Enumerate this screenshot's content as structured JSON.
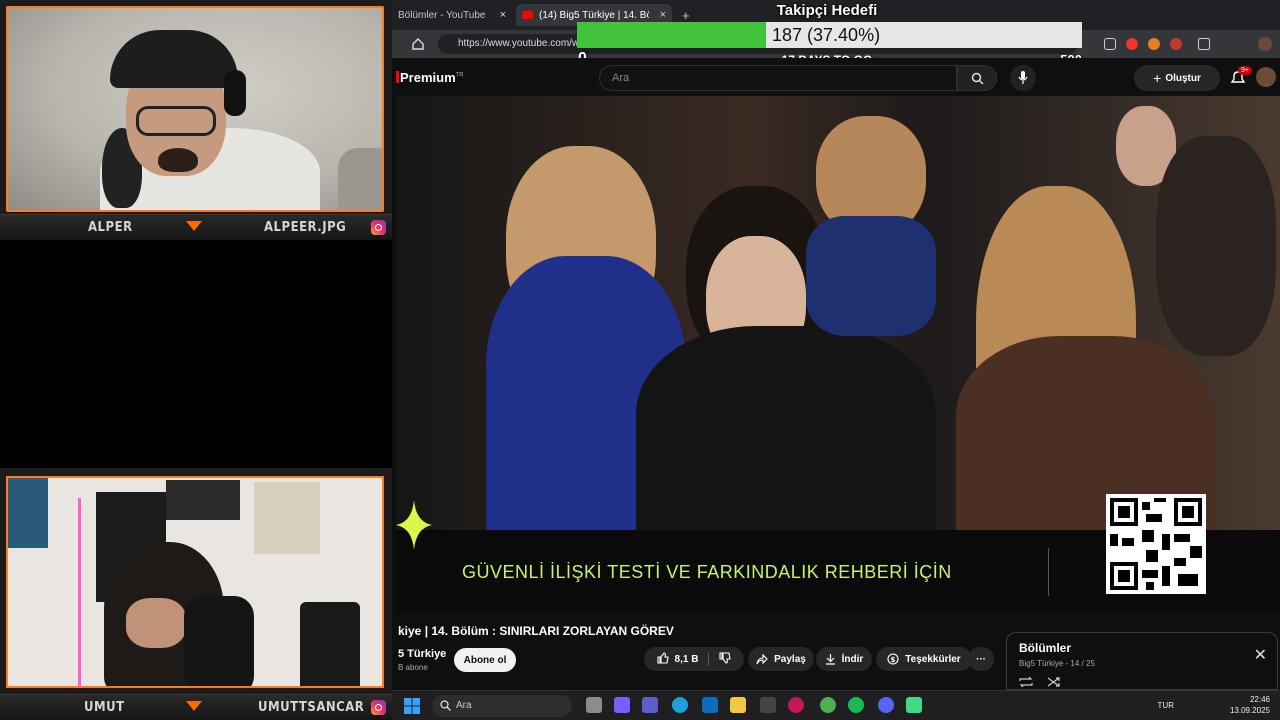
{
  "webcams": {
    "top": {
      "left_name": "ALPER",
      "right_name": "ALPEER.JPG"
    },
    "bottom": {
      "left_name": "UMUT",
      "right_name": "UMUTTSANCAR"
    }
  },
  "browser": {
    "tabs": [
      {
        "label": "Bölümler - YouTube",
        "close": "×"
      },
      {
        "label": "(14) Big5 Türkiye | 14. Bölüm",
        "close": "×"
      }
    ],
    "new_tab": "+",
    "url": "https://www.youtube.com/wa"
  },
  "goal_overlay": {
    "title": "Takipçi Hedefi",
    "current_label": "187 (37.40%)",
    "progress_fraction": 0.374,
    "min": "0",
    "max": "500",
    "days_left": "17 DAYS TO GO"
  },
  "youtube": {
    "logo": "Premium",
    "logo_region": "TR",
    "search_placeholder": "Ara",
    "create_label": "Oluştur",
    "notification_count": "9+",
    "banner_text": "GÜVENLİ İLİŞKİ TESTİ VE FARKINDALIK REHBERİ İÇİN",
    "video_title": "kiye | 14. Bölüm : SINIRLARI ZORLAYAN GÖREV",
    "channel_name": "5 Türkiye",
    "subscribers": "B abone",
    "subscribe_label": "Abone ol",
    "like_count": "8,1 B",
    "share_label": "Paylaş",
    "download_label": "İndir",
    "thanks_label": "Teşekkürler",
    "more_label": "···",
    "episodes": {
      "title": "Bölümler",
      "subtitle": "Big5 Türkiye - 14 / 25",
      "close": "✕"
    }
  },
  "taskbar": {
    "search_placeholder": "Ara",
    "lang": "TUR",
    "time": "22:46",
    "date": "13.09.2025"
  },
  "colors": {
    "accent_orange": "#ff7a1a",
    "goal_fill": "#43c33d",
    "banner_text": "#c7f26a",
    "yt_red": "#ff0000"
  }
}
